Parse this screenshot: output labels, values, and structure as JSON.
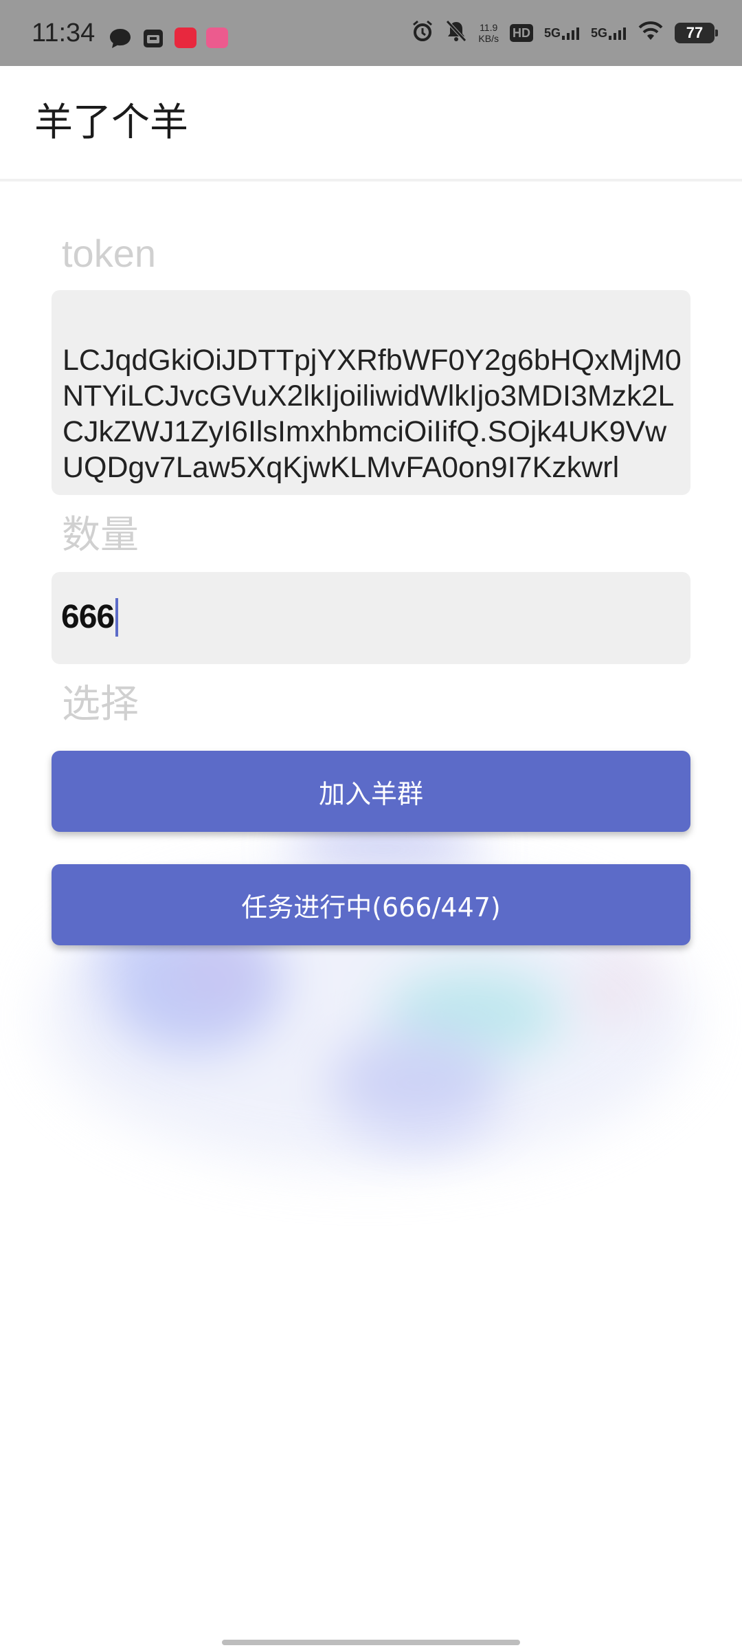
{
  "status_bar": {
    "time": "11:34",
    "net_speed_value": "11.9",
    "net_speed_unit": "KB/s",
    "hd_label": "HD",
    "sim1_label": "5G",
    "sim2_label": "5G",
    "battery": "77"
  },
  "app_bar": {
    "title": "羊了个羊"
  },
  "form": {
    "token_label": "token",
    "token_value": "LCJqdGkiOiJDTTpjYXRfbWF0Y2g6bHQxMjM0NTYiLCJvcGVuX2lkIjoiliwidWlkIjo3MDI3Mzk2LCJkZWJ1ZyI6IlsImxhbmciOiIifQ.SOjk4UK9VwUQDgv7Law5XqKjwKLMvFA0on9I7Kzkwrl",
    "quantity_label": "数量",
    "quantity_value": "666",
    "select_label": "选择"
  },
  "buttons": {
    "join_label": "加入羊群",
    "task_label": "任务进行中(666/447)"
  },
  "colors": {
    "primary": "#5c6bc8",
    "field_bg": "#efefef",
    "label": "#d0d0d0"
  }
}
